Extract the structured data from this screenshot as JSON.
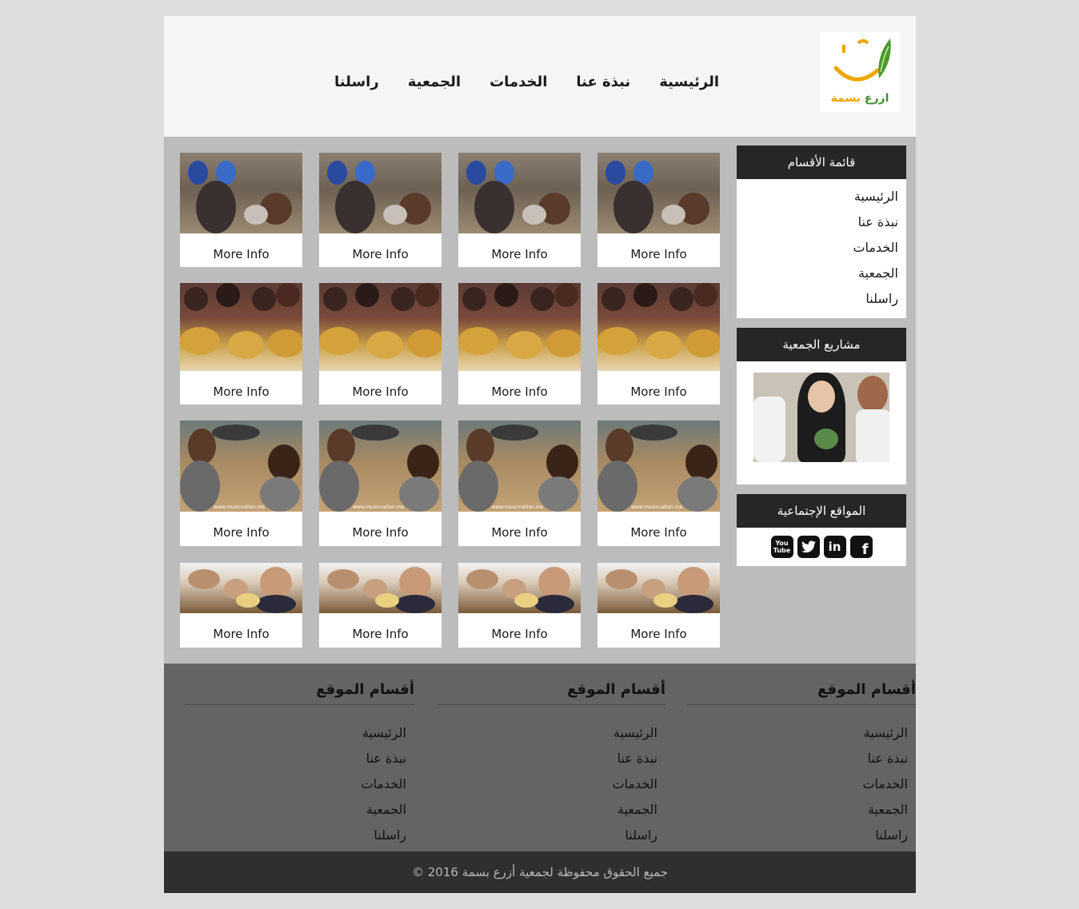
{
  "header": {
    "logo_text_green": "ازرع",
    "logo_text_orange": "بسمة",
    "nav": [
      "الرئيسية",
      "نبذة عنا",
      "الخدمات",
      "الجمعية",
      "راسلنا"
    ]
  },
  "sidebar": {
    "categories_title": "قائمة الأقسام",
    "categories": [
      "الرئيسية",
      "نبذة عنا",
      "الخدمات",
      "الجمعية",
      "راسلنا"
    ],
    "projects_title": "مشاريع الجمعية",
    "social_title": "المواقع الإجتماعية",
    "social_icons": [
      "facebook-icon",
      "linkedin-icon",
      "twitter-icon",
      "youtube-icon"
    ]
  },
  "grid": {
    "card_label": "More Info",
    "rows": 4,
    "cols": 4,
    "watermark": "www.musicnation.me"
  },
  "footer": {
    "columns": [
      {
        "title": "أقسام الموقع",
        "items": [
          "الرئيسية",
          "نبذة عنا",
          "الخدمات",
          "الجمعية",
          "راسلنا"
        ]
      },
      {
        "title": "أقسام الموقع",
        "items": [
          "الرئيسية",
          "نبذة عنا",
          "الخدمات",
          "الجمعية",
          "راسلنا"
        ]
      },
      {
        "title": "أقسام الموقع",
        "items": [
          "الرئيسية",
          "نبذة عنا",
          "الخدمات",
          "الجمعية",
          "راسلنا"
        ]
      }
    ],
    "copyright": "جميع الحقوق محفوظة لجمعية أزرع بسمة 2016 ©"
  }
}
